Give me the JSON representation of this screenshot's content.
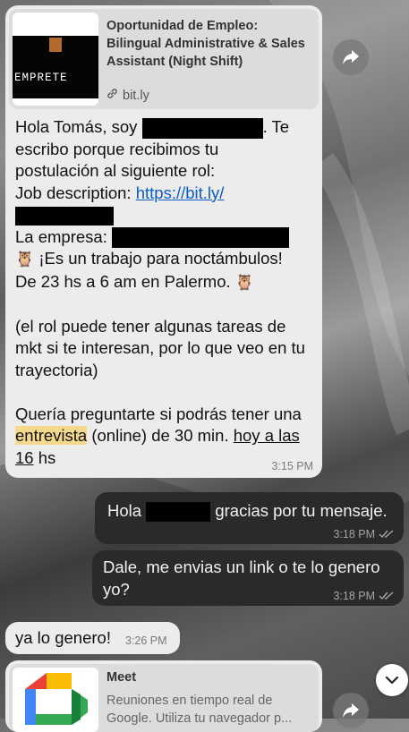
{
  "msg1": {
    "preview": {
      "title": "Oportunidad de Empleo: Bilingual Administrative & Sales Assistant (Night Shift)",
      "domain": "bit.ly",
      "thumb_text": "EMPRETE"
    },
    "greeting": "Hola Tomás, soy",
    "greeting_after": ". Te",
    "line2": "escribo porque recibimos tu",
    "line3": "postulación al siguiente rol:",
    "job_label": "Job description:",
    "job_link": "https://bit.ly/",
    "company_label": "La empresa:",
    "owl_line1_emoji": "🦉",
    "owl_line1": "¡Es un trabajo para noctámbulos!",
    "schedule": "De 23 hs a 6 am en Palermo.",
    "owl_end_emoji": "🦉",
    "para2": "(el rol puede tener algunas tareas de mkt si te interesan, por lo que veo en tu trayectoria)",
    "q_part1": "Quería preguntarte si podrás tener una",
    "q_highlight": "entrevista",
    "q_part2": "(online) de 30 min.",
    "q_link1": "hoy a las",
    "q_link2": "16",
    "q_end": "hs",
    "time": "3:15 PM"
  },
  "msg2": {
    "before": "Hola",
    "after": "gracias por tu mensaje.",
    "time": "3:18 PM"
  },
  "msg3": {
    "line1": "Dale, me envias un link o te lo genero",
    "line2": "yo?",
    "time": "3:18 PM"
  },
  "msg4": {
    "text": "ya lo genero!",
    "time": "3:26 PM"
  },
  "msg5": {
    "title": "Meet",
    "desc1": "Reuniones en tiempo real de",
    "desc2": "Google. Utiliza tu navegador p..."
  },
  "colors": {
    "incoming_bubble": "#ececec",
    "outgoing_bubble": "#2a2a2a",
    "link": "#0b5cc4",
    "highlight": "#f7d98b"
  }
}
